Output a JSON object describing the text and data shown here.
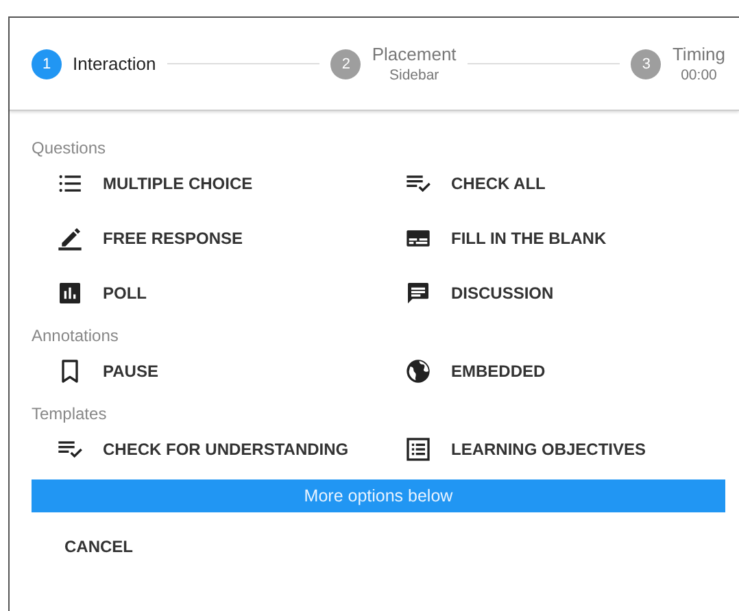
{
  "steps": [
    {
      "number": "1",
      "label": "Interaction",
      "selected": true
    },
    {
      "number": "2",
      "label": "Placement",
      "sublabel": "Sidebar",
      "selected": false
    },
    {
      "number": "3",
      "label": "Timing",
      "sublabel": "00:00",
      "selected": false
    }
  ],
  "sections": [
    {
      "title": "Questions",
      "items": [
        "MULTIPLE CHOICE",
        "CHECK ALL",
        "FREE RESPONSE",
        "FILL IN THE BLANK",
        "POLL",
        "DISCUSSION"
      ]
    },
    {
      "title": "Annotations",
      "items": [
        "PAUSE",
        "EMBEDDED"
      ]
    },
    {
      "title": "Templates",
      "items": [
        "CHECK FOR UNDERSTANDING",
        "LEARNING OBJECTIVES"
      ]
    }
  ],
  "banner": "More options below",
  "cancel_button": "CANCEL"
}
